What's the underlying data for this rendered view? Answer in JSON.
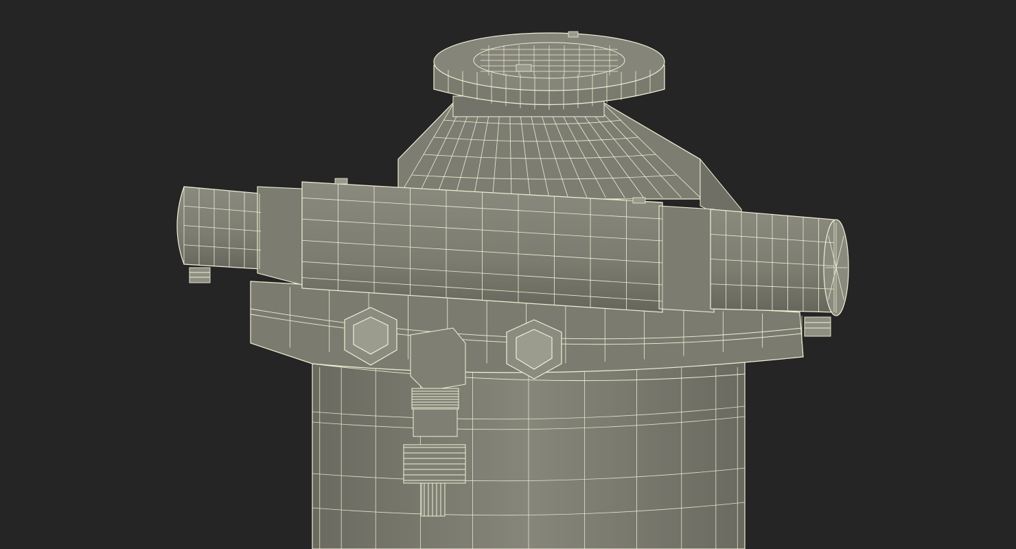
{
  "scene": {
    "subject": "wireframe-3d-model",
    "background_color": "#252525",
    "surface_color": "#7f7f73",
    "surface_dark_color": "#6c6c62",
    "wire_color": "#f2f1d6",
    "icons": [
      "hex-bolt-icon",
      "cable-gland-icon",
      "cap-nut-icon"
    ]
  }
}
